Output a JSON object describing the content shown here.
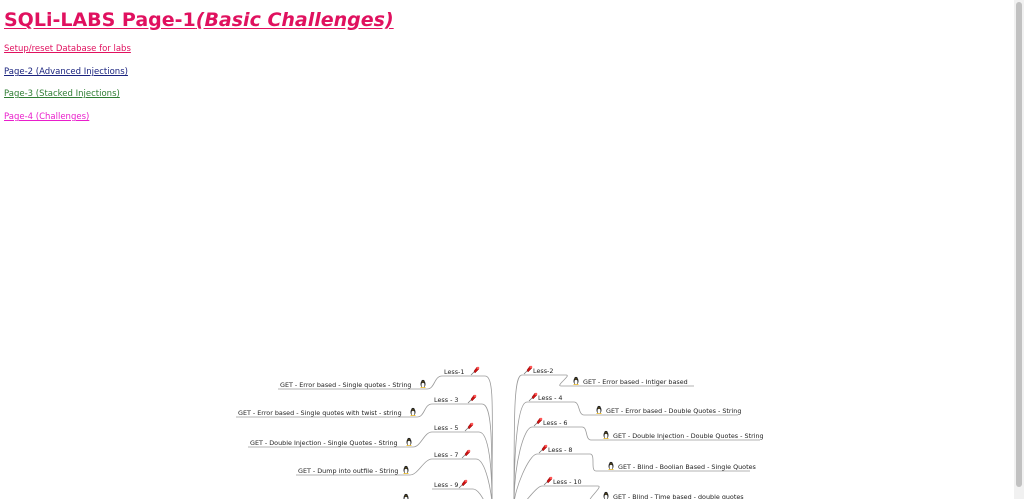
{
  "header": {
    "title_main": "SQLi-LABS Page-1",
    "title_sub": "(Basic Challenges)"
  },
  "links": [
    {
      "label": "Setup/reset Database for labs",
      "color": "#e0115f"
    },
    {
      "label": "Page-2 (Advanced Injections)",
      "color": "#1a237e"
    },
    {
      "label": "Page-3 (Stacked Injections)",
      "color": "#2e7d32"
    },
    {
      "label": "Page-4 (Challenges)",
      "color": "#e91ecb"
    }
  ],
  "mindmap": {
    "left": [
      {
        "lesson": "Less-1",
        "desc": "GET - Error based - Single quotes - String"
      },
      {
        "lesson": "Less - 3",
        "desc": "GET - Error based - Single quotes with twist - string"
      },
      {
        "lesson": "Less - 5",
        "desc": "GET - Double Injection - Single Quotes - String"
      },
      {
        "lesson": "Less - 7",
        "desc": "GET - Dump into outfile - String"
      },
      {
        "lesson": "Less - 9",
        "desc": ""
      }
    ],
    "right": [
      {
        "lesson": "Less-2",
        "desc": "GET - Error based - Intiger based"
      },
      {
        "lesson": "Less - 4",
        "desc": "GET - Error based - Double Quotes - String"
      },
      {
        "lesson": "Less - 6",
        "desc": "GET - Double Injection - Double Quotes - String"
      },
      {
        "lesson": "Less - 8",
        "desc": "GET - Blind - Boolian Based - Single Quotes"
      },
      {
        "lesson": "Less - 10",
        "desc": "GET - Blind - Time based - double quotes"
      }
    ],
    "icons": {
      "lesson": "pin-icon",
      "desc": "penguin-icon"
    },
    "colors": {
      "pin": "#cc1111",
      "line": "#9a9a9a"
    }
  }
}
